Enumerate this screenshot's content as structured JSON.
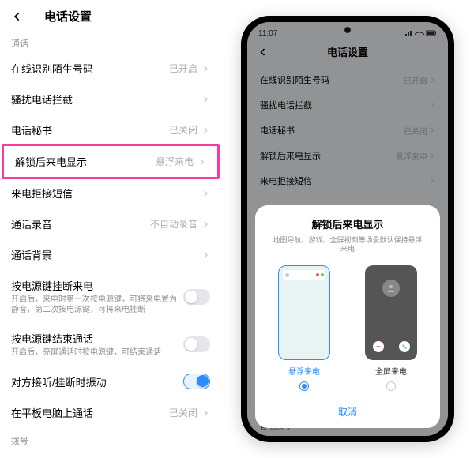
{
  "left": {
    "title": "电话设置",
    "section_call": "通话",
    "rows": [
      {
        "title": "在线识别陌生号码",
        "value": "已开启"
      },
      {
        "title": "骚扰电话拦截",
        "value": ""
      },
      {
        "title": "电话秘书",
        "value": "已关闭"
      },
      {
        "title": "解锁后来电显示",
        "value": "悬浮来电"
      },
      {
        "title": "来电拒接短信",
        "value": ""
      },
      {
        "title": "通话录音",
        "value": "不自动录音"
      },
      {
        "title": "通话背景",
        "value": ""
      },
      {
        "title": "按电源键挂断来电",
        "sub": "开启后，来电时第一次按电源键，可将来电置为静音，第二次按电源键，可将来电挂断"
      },
      {
        "title": "按电源键结束通话",
        "sub": "开启后，亮屏通话时按电源键，可结束通话"
      },
      {
        "title": "对方接听/挂断时振动",
        "toggle_on": true
      },
      {
        "title": "在平板电脑上通话",
        "value": "已关闭"
      }
    ],
    "section_dial": "拨号"
  },
  "phone": {
    "time": "11:07",
    "title": "电话设置",
    "rows": [
      {
        "title": "在线识别陌生号码",
        "value": "已开启"
      },
      {
        "title": "骚扰电话拦截",
        "value": ""
      },
      {
        "title": "电话秘书",
        "value": "已关闭"
      },
      {
        "title": "解锁后来电显示",
        "value": "悬浮来电"
      },
      {
        "title": "来电拒接短信",
        "value": ""
      }
    ],
    "sheet": {
      "title": "解锁后来电显示",
      "sub": "地图导航、游戏、全屏视频等场景默认保持悬浮来电",
      "opt1": "悬浮来电",
      "opt2": "全屏来电",
      "cancel": "取消"
    },
    "row_smart_dial": "智能拨号"
  }
}
